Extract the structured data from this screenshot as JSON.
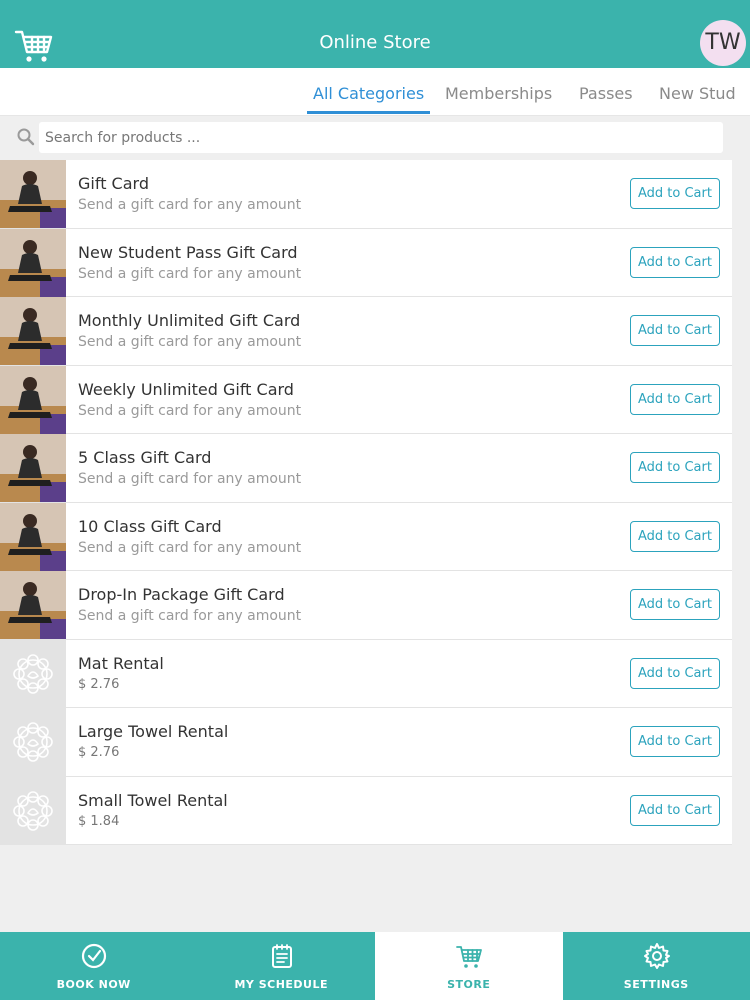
{
  "header": {
    "title": "Online Store",
    "avatar_initials": "TW",
    "cart_icon": "cart-icon"
  },
  "tabs": [
    {
      "label": "All Categories",
      "active": true
    },
    {
      "label": "Memberships",
      "active": false
    },
    {
      "label": "Passes",
      "active": false
    },
    {
      "label": "New Stud",
      "active": false
    }
  ],
  "search": {
    "placeholder": "Search for products ...",
    "icon": "search-icon"
  },
  "products": [
    {
      "title": "Gift Card",
      "subtitle": "Send a gift card for any amount",
      "thumb": "photo",
      "button": "Add to Cart"
    },
    {
      "title": "New Student Pass Gift Card",
      "subtitle": "Send a gift card for any amount",
      "thumb": "photo",
      "button": "Add to Cart"
    },
    {
      "title": "Monthly Unlimited Gift Card",
      "subtitle": "Send a gift card for any amount",
      "thumb": "photo",
      "button": "Add to Cart"
    },
    {
      "title": "Weekly Unlimited Gift Card",
      "subtitle": "Send a gift card for any amount",
      "thumb": "photo",
      "button": "Add to Cart"
    },
    {
      "title": "5 Class Gift Card",
      "subtitle": "Send a gift card for any amount",
      "thumb": "photo",
      "button": "Add to Cart"
    },
    {
      "title": "10 Class Gift Card",
      "subtitle": "Send a gift card for any amount",
      "thumb": "photo",
      "button": "Add to Cart"
    },
    {
      "title": "Drop-In Package Gift Card",
      "subtitle": "Send a gift card for any amount",
      "thumb": "photo",
      "button": "Add to Cart"
    },
    {
      "title": "Mat Rental",
      "subtitle": "$ 2.76",
      "thumb": "plain",
      "button": "Add to Cart"
    },
    {
      "title": "Large Towel Rental",
      "subtitle": "$ 2.76",
      "thumb": "plain",
      "button": "Add to Cart"
    },
    {
      "title": "Small Towel Rental",
      "subtitle": "$ 1.84",
      "thumb": "plain",
      "button": "Add to Cart"
    }
  ],
  "bottom_nav": [
    {
      "label": "BOOK NOW",
      "icon": "check-circle-icon",
      "active": false
    },
    {
      "label": "MY SCHEDULE",
      "icon": "calendar-icon",
      "active": false
    },
    {
      "label": "STORE",
      "icon": "cart-icon",
      "active": true
    },
    {
      "label": "SETTINGS",
      "icon": "gear-icon",
      "active": false
    }
  ],
  "colors": {
    "brand_teal": "#3bb3ac",
    "accent_blue": "#2f8fd6",
    "button_blue": "#2ca3bd"
  }
}
